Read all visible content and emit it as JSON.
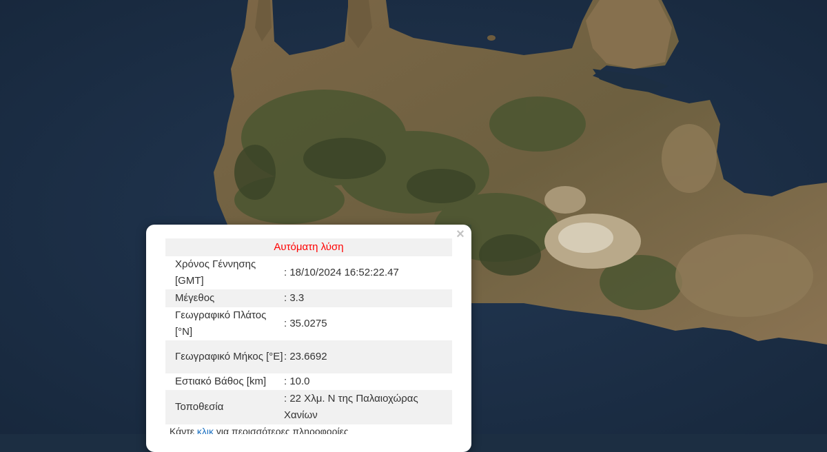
{
  "popup": {
    "close": "×",
    "title": "Αυτόματη λύση",
    "rows": [
      {
        "label": "Χρόνος Γέννησης [GMT]",
        "value": ": 18/10/2024 16:52:22.47"
      },
      {
        "label": "Μέγεθος",
        "value": ": 3.3"
      },
      {
        "label": "Γεωγραφικό Πλάτος [°N]",
        "value": ": 35.0275"
      },
      {
        "label": "Γεωγραφικό Μήκος [°E]",
        "value": ": 23.6692"
      },
      {
        "label": "Εστιακό Βάθος [km]",
        "value": ": 10.0"
      },
      {
        "label": "Τοποθεσία",
        "value": ": 22 Χλμ. Ν της Παλαιοχώρας Χανίων"
      }
    ],
    "footer_pre": "Κάντε ",
    "footer_link": "κλικ",
    "footer_post": " για περισσότερες πληροφορίες"
  },
  "colors": {
    "sea": "#1c2e42",
    "land": "#7a6544",
    "mountain": "#4f5a33",
    "title_red": "#ff0000"
  }
}
